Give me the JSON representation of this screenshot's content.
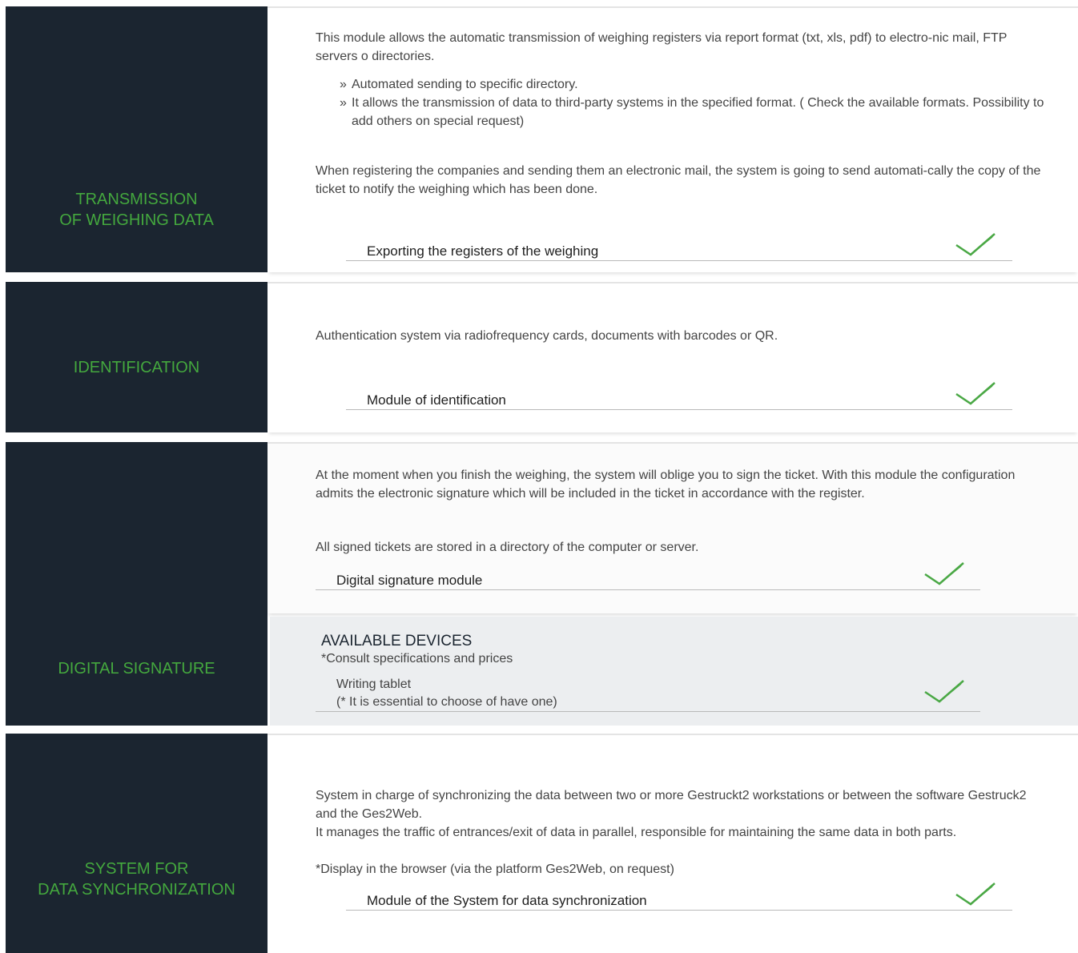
{
  "colors": {
    "panel": "#1b2530",
    "accent_green": "#44a83e",
    "check_green": "#4aa845",
    "divider": "#b9b9b9",
    "devices_bg": "#eceef0"
  },
  "icons": {
    "check": "checkmark-icon"
  },
  "sections": [
    {
      "title": "TRANSMISSION\nOF WEIGHING DATA",
      "paragraphs": [
        "This module allows the automatic transmission of weighing registers via report format (txt, xls, pdf) to electro-nic mail, FTP servers o directories.",
        "When registering the companies and sending them an electronic mail, the system is going to send automati-cally the copy of the ticket to notify the weighing which has been done."
      ],
      "bullets": [
        "Automated sending to specific directory.",
        "It allows the transmission of data to third-party systems in the specified format. ( Check the available formats. Possibility to add others on special request)"
      ],
      "feature": "Exporting the registers of the weighing"
    },
    {
      "title": "IDENTIFICATION",
      "paragraphs": [
        "Authentication system via radiofrequency cards, documents with barcodes or QR."
      ],
      "feature": "Module of  identification"
    },
    {
      "title": "DIGITAL SIGNATURE",
      "paragraphs": [
        "At the moment when you finish the weighing, the system will oblige you to sign the ticket. With this module the configuration admits the electronic signature which will be included in the ticket in accordance with the register.",
        "All signed tickets are stored in a directory of the computer or server."
      ],
      "feature": "Digital signature module",
      "devices": {
        "heading": "AVAILABLE DEVICES",
        "note": "*Consult specifications and prices",
        "item_line1": "Writing tablet",
        "item_line2": "(* It is essential to choose of have one)"
      }
    },
    {
      "title": "SYSTEM FOR\nDATA SYNCHRONIZATION",
      "paragraphs": [
        "System in charge of synchronizing the data between two or more Gestruckt2 workstations or between the software Gestruck2 and the Ges2Web.",
        "It manages the traffic of entrances/exit of data in parallel, responsible for maintaining the same data in both parts.",
        "*Display in the browser (via the platform Ges2Web, on request)"
      ],
      "feature": "Module of the System for data synchronization"
    }
  ]
}
